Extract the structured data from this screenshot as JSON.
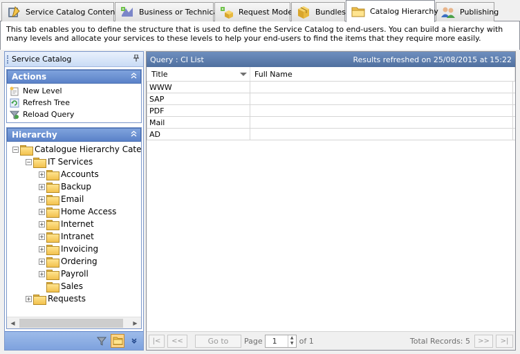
{
  "tabs": [
    {
      "label": "Service Catalog Contents",
      "icon": "catalog-book-icon",
      "active": false
    },
    {
      "label": "Business or Technical",
      "icon": "business-technical-icon",
      "active": false
    },
    {
      "label": "Request Mode",
      "icon": "request-mode-icon",
      "active": false
    },
    {
      "label": "Bundles",
      "icon": "bundles-box-icon",
      "active": false
    },
    {
      "label": "Catalog Hierarchy",
      "icon": "folder-icon",
      "active": true
    },
    {
      "label": "Publishing",
      "icon": "publishing-users-icon",
      "active": false
    }
  ],
  "description": "This tab enables you to define the structure that is used to define the Service Catalog to end-users. You can build a hierarchy with many levels and allocate your services to these levels to help your end-users to find the items that they require more easily.",
  "left_panel": {
    "title": "Service Catalog",
    "actions": {
      "title": "Actions",
      "items": [
        {
          "label": "New Level",
          "icon": "new-level-icon"
        },
        {
          "label": "Refresh Tree",
          "icon": "refresh-icon"
        },
        {
          "label": "Reload Query",
          "icon": "reload-query-icon"
        }
      ]
    },
    "hierarchy": {
      "title": "Hierarchy",
      "root": "Catalogue Hierarchy Catego",
      "it_services": "IT Services",
      "children": [
        "Accounts",
        "Backup",
        "Email",
        "Home Access",
        "Internet",
        "Intranet",
        "Invoicing",
        "Ordering",
        "Payroll",
        "Sales"
      ],
      "requests": "Requests"
    },
    "footer_icons": [
      "filter-icon",
      "folder-icon",
      "expand-more-icon"
    ]
  },
  "query": {
    "title": "Query : CI List",
    "refreshed": "Results refreshed on 25/08/2015 at 15:22",
    "columns": [
      "Title",
      "Full Name"
    ],
    "rows": [
      {
        "title": "WWW",
        "full_name": ""
      },
      {
        "title": "SAP",
        "full_name": ""
      },
      {
        "title": "PDF",
        "full_name": ""
      },
      {
        "title": "Mail",
        "full_name": ""
      },
      {
        "title": "AD",
        "full_name": ""
      }
    ]
  },
  "pager": {
    "first": "|<",
    "prev": "<<",
    "goto": "Go to",
    "page_label": "Page",
    "page_value": "1",
    "of_label": "of 1",
    "total": "Total Records: 5",
    "next": ">>",
    "last": ">|"
  }
}
